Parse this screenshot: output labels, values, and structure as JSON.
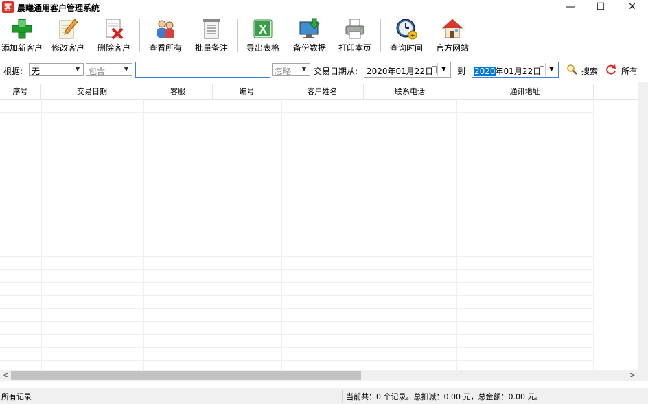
{
  "window": {
    "icon_char": "客",
    "title": "晨曦通用客户管理系统",
    "minimize": "—",
    "maximize": "☐",
    "close": "✕"
  },
  "toolbar": {
    "add": "添加新客户",
    "edit": "修改客户",
    "delete": "删除客户",
    "view_all": "查看所有",
    "batch_note": "批量备注",
    "export": "导出表格",
    "backup": "备份数据",
    "print": "打印本页",
    "query_time": "查询时间",
    "website": "官方网站"
  },
  "filter": {
    "basis_label": "根据:",
    "basis_value": "无",
    "match_value": "包含",
    "keyword_value": "",
    "ignore_value": "忽略",
    "date_from_label": "交易日期从:",
    "date_from": "2020年01月22日",
    "to_label": "到",
    "date_to_year": "2020",
    "date_to_rest": "年01月22日",
    "search": "搜索",
    "all": "所有"
  },
  "grid": {
    "columns": [
      "序号",
      "交易日期",
      "客服",
      "编号",
      "客户姓名",
      "联系电话",
      "通讯地址"
    ],
    "rows": []
  },
  "status": {
    "left": "所有记录",
    "right": "当前共：0 个记录。总扣减：0.00 元，总金额：0.00 元。"
  }
}
